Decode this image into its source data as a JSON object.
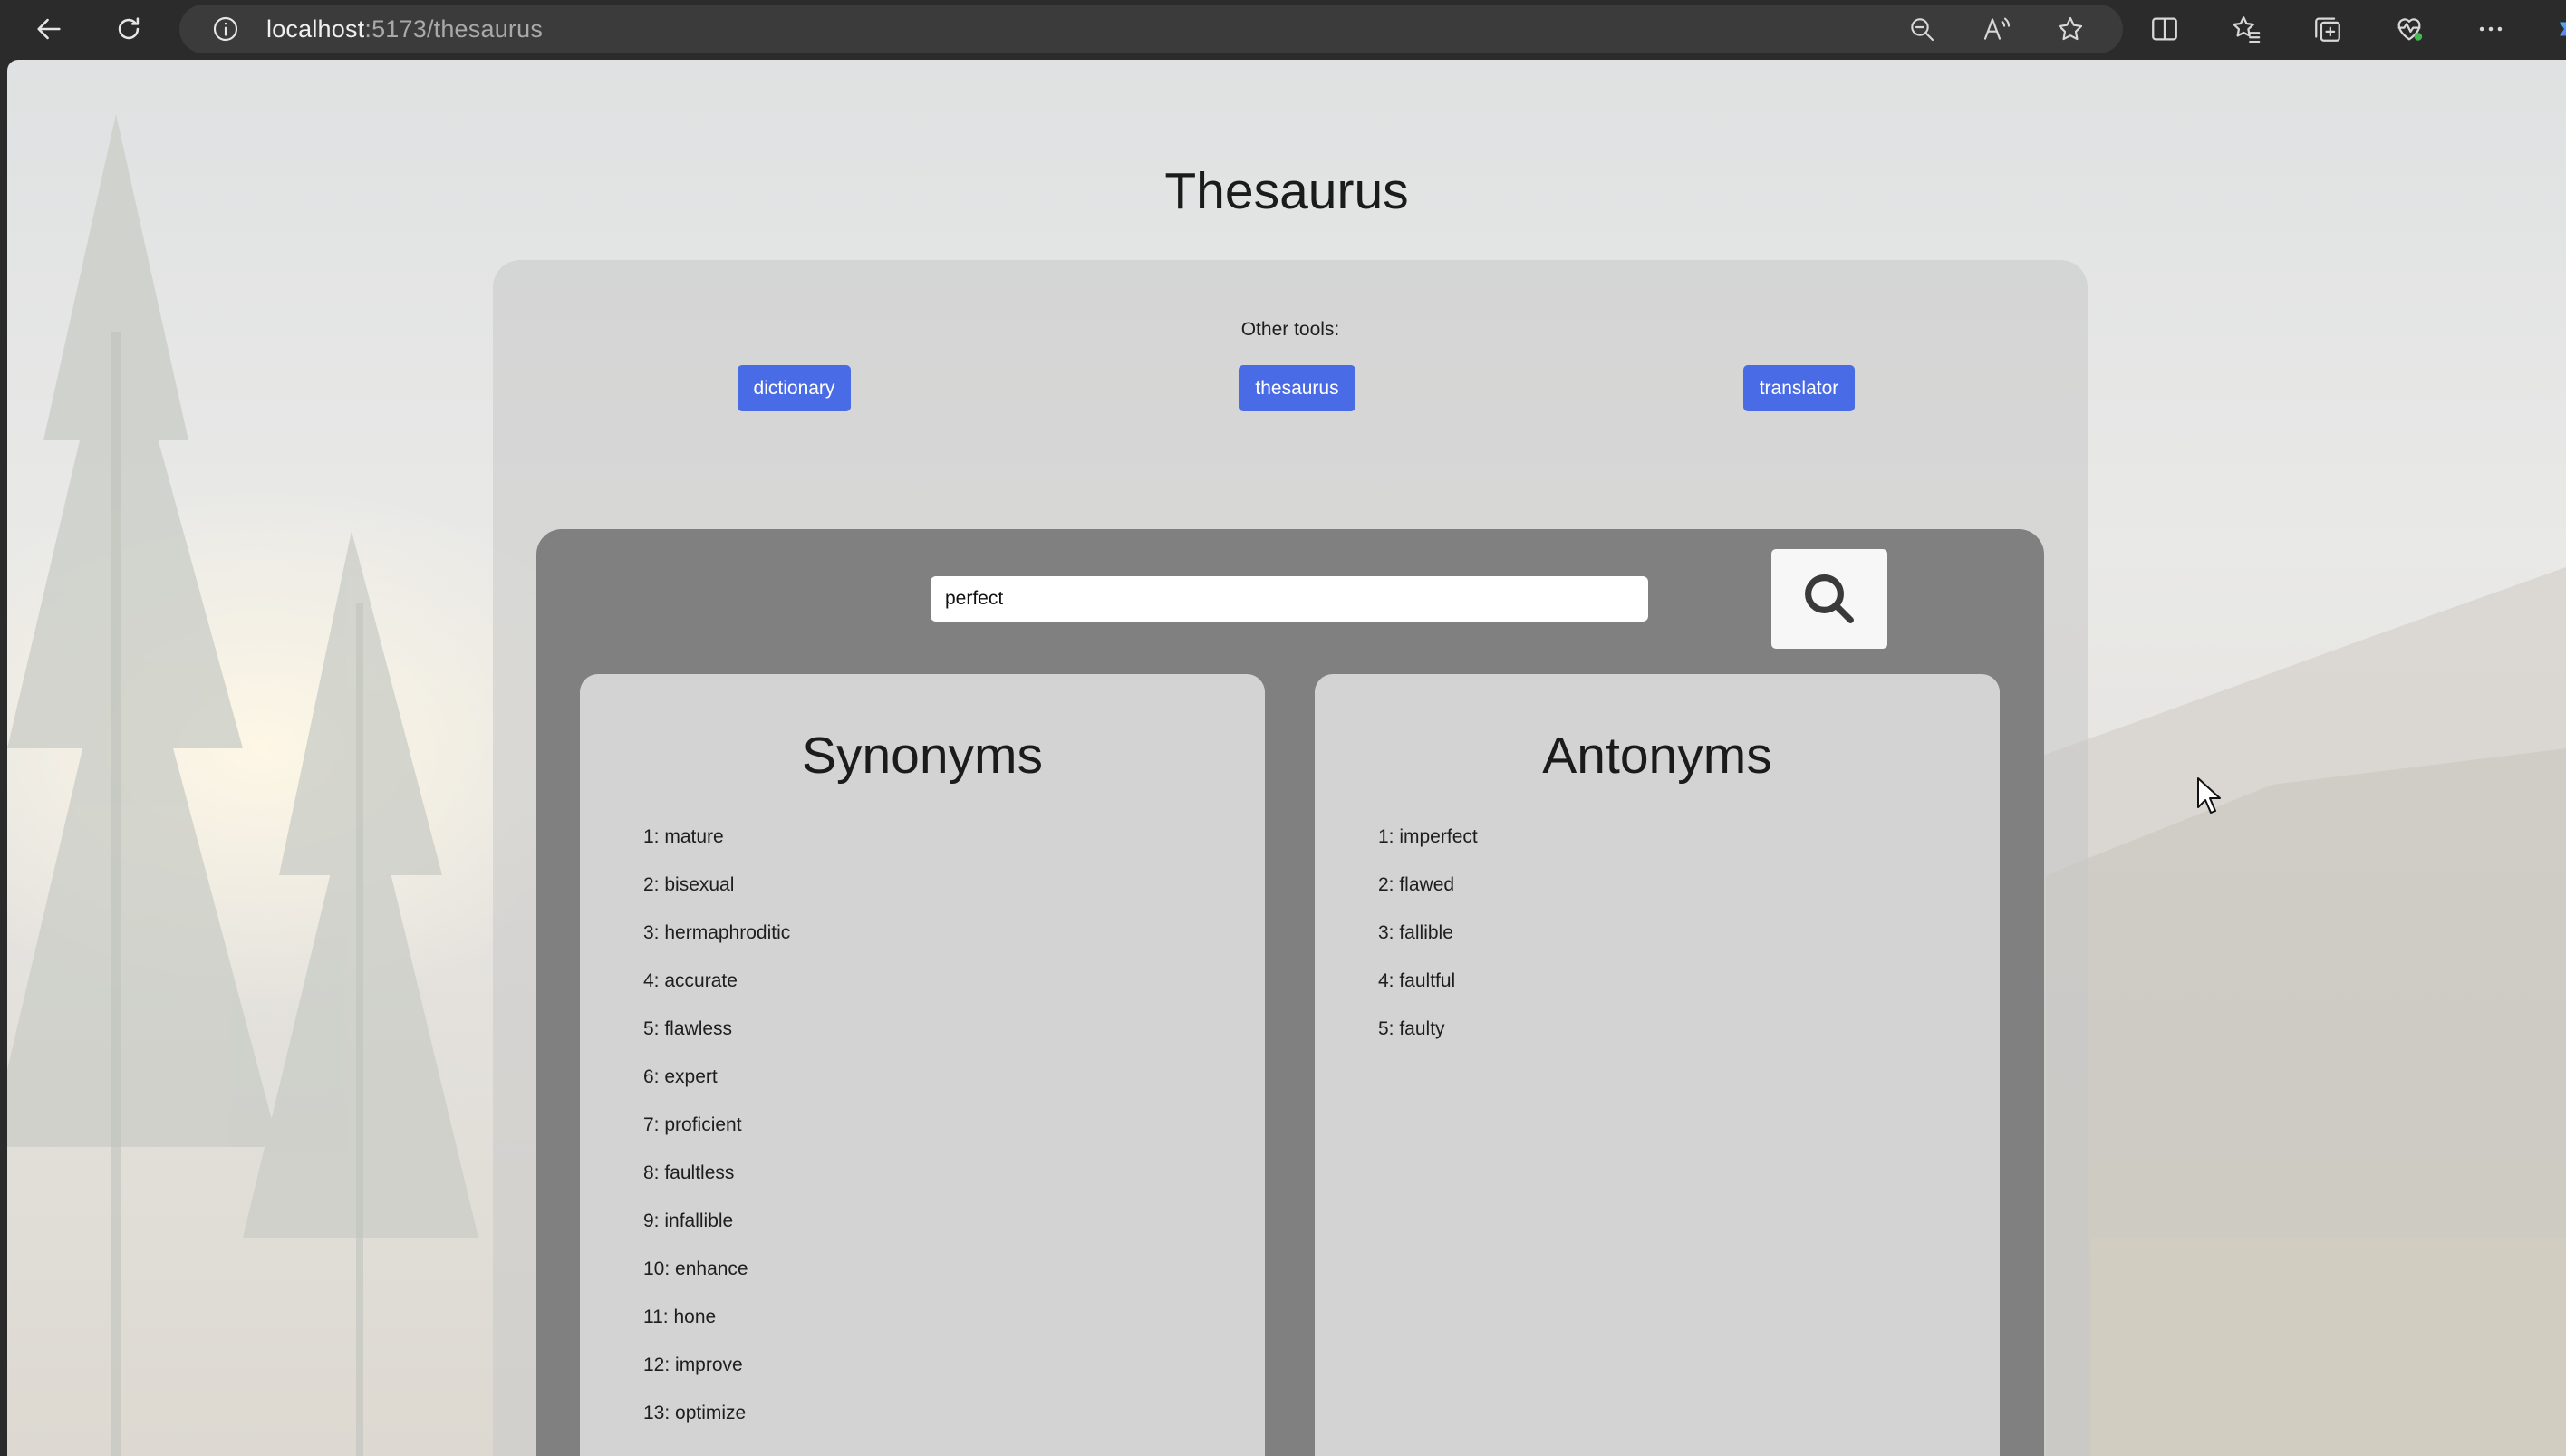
{
  "browser": {
    "url_host": "localhost",
    "url_path": ":5173/thesaurus"
  },
  "page": {
    "title": "Thesaurus",
    "other_tools_label": "Other tools:",
    "tools": [
      {
        "label": "dictionary"
      },
      {
        "label": "thesaurus"
      },
      {
        "label": "translator"
      }
    ]
  },
  "search": {
    "value": "perfect",
    "icon": "search-icon"
  },
  "synonyms": {
    "heading": "Synonyms",
    "items": [
      "1: mature",
      "2: bisexual",
      "3: hermaphroditic",
      "4: accurate",
      "5: flawless",
      "6: expert",
      "7: proficient",
      "8: faultless",
      "9: infallible",
      "10: enhance",
      "11: hone",
      "12: improve",
      "13: optimize"
    ]
  },
  "antonyms": {
    "heading": "Antonyms",
    "items": [
      "1: imperfect",
      "2: flawed",
      "3: fallible",
      "4: faultful",
      "5: faulty"
    ]
  },
  "colors": {
    "accent": "#4a6be6",
    "inner_panel": "#808080",
    "list_panel": "#d3d3d3"
  }
}
